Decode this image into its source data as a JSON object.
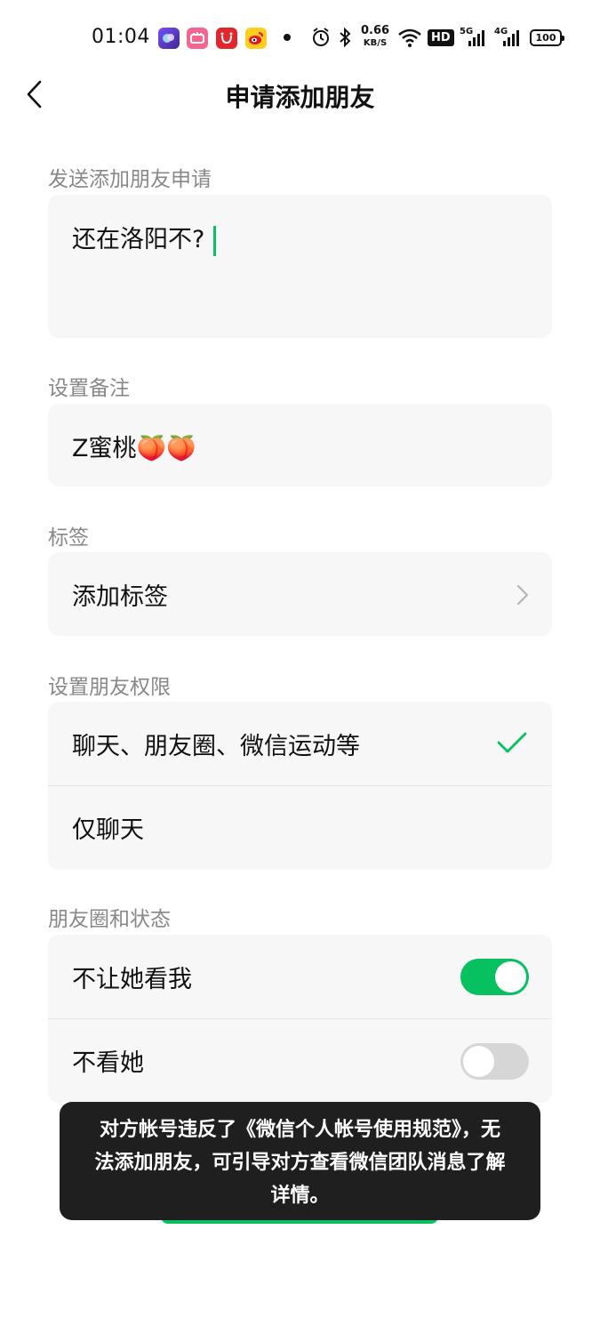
{
  "status_bar": {
    "time": "01:04",
    "net_speed_value": "0.66",
    "net_speed_unit": "KB/S",
    "hd_label": "HD",
    "signal1_label": "5G",
    "signal2_label": "4G",
    "battery": "100",
    "app_icons": [
      "gallery-app-icon",
      "pink-app-icon",
      "red-shopping-app-icon",
      "weibo-app-icon"
    ]
  },
  "nav": {
    "title": "申请添加朋友"
  },
  "request_section": {
    "label": "发送添加朋友申请",
    "message": "还在洛阳不?"
  },
  "remark_section": {
    "label": "设置备注",
    "value": "Z蜜桃🍑🍑"
  },
  "tag_section": {
    "label": "标签",
    "add_tag": "添加标签"
  },
  "permission_section": {
    "label": "设置朋友权限",
    "options": [
      {
        "label": "聊天、朋友圈、微信运动等",
        "selected": true
      },
      {
        "label": "仅聊天",
        "selected": false
      }
    ]
  },
  "moments_section": {
    "label": "朋友圈和状态",
    "items": [
      {
        "label": "不让她看我",
        "on": true
      },
      {
        "label": "不看她",
        "on": false
      }
    ]
  },
  "toast": {
    "line1": "对方帐号违反了《微信个人帐号使用规范》，无",
    "line2": "法添加朋友，可引导对方查看微信团队消息了解",
    "line3": "详情。"
  },
  "colors": {
    "accent": "#07c160",
    "label": "#888888",
    "card": "#f7f7f7",
    "toast": "#1f1f1f"
  }
}
